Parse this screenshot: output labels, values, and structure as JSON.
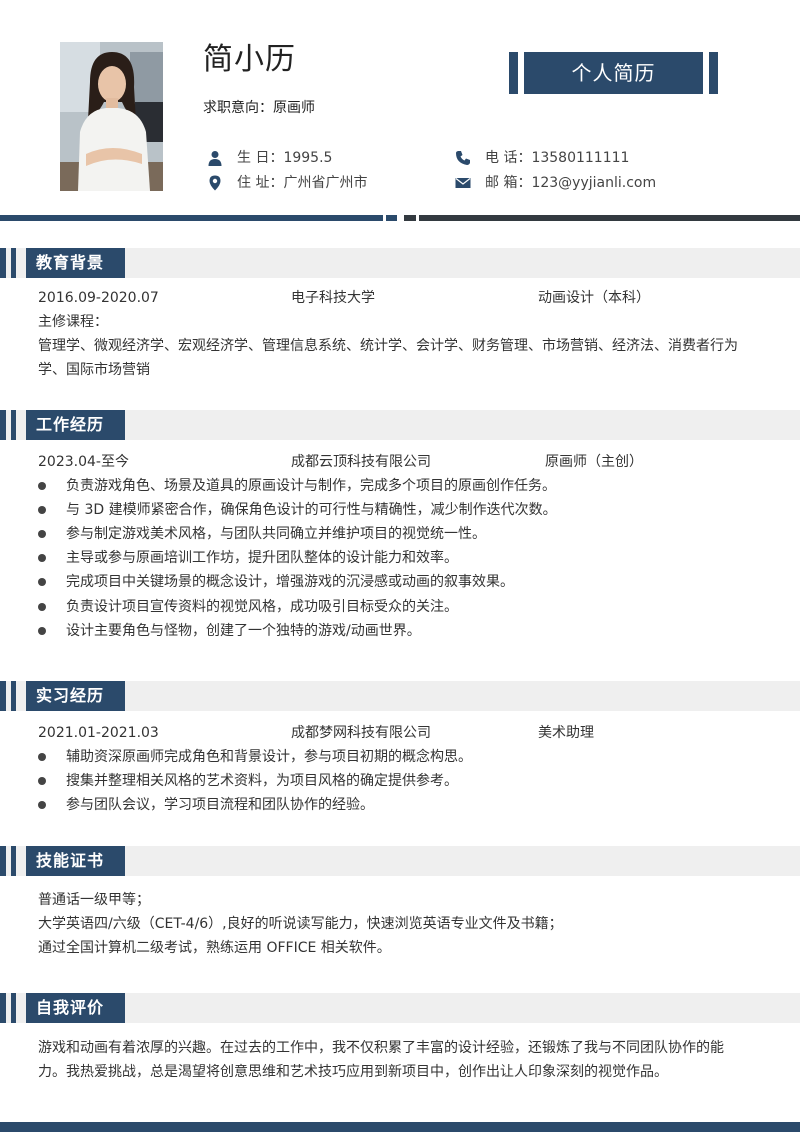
{
  "header": {
    "name": "简小历",
    "intent": "求职意向：原画师",
    "banner": "个人简历"
  },
  "info": {
    "birth": "生  日：1995.5",
    "phone": "电  话：13580111111",
    "address": "住  址：广州省广州市",
    "email": "邮  箱：123@yyjianli.com"
  },
  "icons": {
    "birth": "person-icon",
    "phone": "phone-icon",
    "address": "location-pin-icon",
    "email": "envelope-icon"
  },
  "colors": {
    "accent": "#2b4a6b",
    "dark": "#333a40",
    "section_bg": "#efefef"
  },
  "education": {
    "title": "教育背景",
    "date": "2016.09-2020.07",
    "school": "电子科技大学",
    "major": "动画设计（本科）",
    "courses_label": "主修课程：",
    "courses": "管理学、微观经济学、宏观经济学、管理信息系统、统计学、会计学、财务管理、市场营销、经济法、消费者行为学、国际市场营销"
  },
  "work": {
    "title": "工作经历",
    "date": "2023.04-至今",
    "company": "成都云顶科技有限公司",
    "role": "原画师（主创）",
    "items": [
      "负责游戏角色、场景及道具的原画设计与制作，完成多个项目的原画创作任务。",
      "与 3D 建模师紧密合作，确保角色设计的可行性与精确性，减少制作迭代次数。",
      "参与制定游戏美术风格，与团队共同确立并维护项目的视觉统一性。",
      "主导或参与原画培训工作坊，提升团队整体的设计能力和效率。",
      "完成项目中关键场景的概念设计，增强游戏的沉浸感或动画的叙事效果。",
      "负责设计项目宣传资料的视觉风格，成功吸引目标受众的关注。",
      "设计主要角色与怪物，创建了一个独特的游戏/动画世界。"
    ]
  },
  "internship": {
    "title": "实习经历",
    "date": "2021.01-2021.03",
    "company": "成都梦网科技有限公司",
    "role": "美术助理",
    "items": [
      "辅助资深原画师完成角色和背景设计，参与项目初期的概念构思。",
      "搜集并整理相关风格的艺术资料，为项目风格的确定提供参考。",
      "参与团队会议，学习项目流程和团队协作的经验。"
    ]
  },
  "skills": {
    "title": "技能证书",
    "lines": [
      "普通话一级甲等；",
      "大学英语四/六级（CET-4/6）,良好的听说读写能力，快速浏览英语专业文件及书籍；",
      "通过全国计算机二级考试，熟练运用 OFFICE 相关软件。"
    ]
  },
  "self": {
    "title": "自我评价",
    "text": "游戏和动画有着浓厚的兴趣。在过去的工作中，我不仅积累了丰富的设计经验，还锻炼了我与不同团队协作的能力。我热爱挑战，总是渴望将创意思维和艺术技巧应用到新项目中，创作出让人印象深刻的视觉作品。"
  }
}
